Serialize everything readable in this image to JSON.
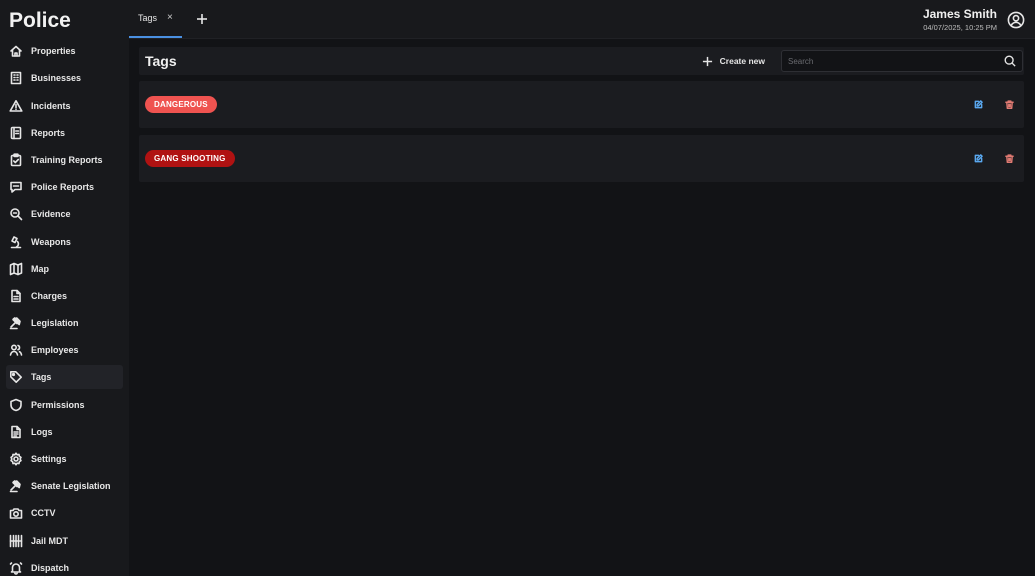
{
  "app": {
    "title": "Police"
  },
  "sidebar": {
    "items": [
      {
        "label": "Properties",
        "icon": "home-icon"
      },
      {
        "label": "Businesses",
        "icon": "building-icon"
      },
      {
        "label": "Incidents",
        "icon": "warning-icon"
      },
      {
        "label": "Reports",
        "icon": "report-icon"
      },
      {
        "label": "Training Reports",
        "icon": "clipboard-icon"
      },
      {
        "label": "Police Reports",
        "icon": "message-icon"
      },
      {
        "label": "Evidence",
        "icon": "magnify-icon"
      },
      {
        "label": "Weapons",
        "icon": "microscope-icon"
      },
      {
        "label": "Map",
        "icon": "map-icon"
      },
      {
        "label": "Charges",
        "icon": "document-icon"
      },
      {
        "label": "Legislation",
        "icon": "gavel-icon"
      },
      {
        "label": "Employees",
        "icon": "users-icon"
      },
      {
        "label": "Tags",
        "icon": "tag-icon"
      },
      {
        "label": "Permissions",
        "icon": "shield-icon"
      },
      {
        "label": "Logs",
        "icon": "file-text-icon"
      },
      {
        "label": "Settings",
        "icon": "gear-icon"
      },
      {
        "label": "Senate Legislation",
        "icon": "gavel-icon"
      },
      {
        "label": "CCTV",
        "icon": "camera-icon"
      },
      {
        "label": "Jail MDT",
        "icon": "jail-icon"
      },
      {
        "label": "Dispatch",
        "icon": "bell-icon"
      }
    ],
    "active": "Tags"
  },
  "tabs": [
    {
      "label": "Tags",
      "close": "×"
    }
  ],
  "user": {
    "name": "James Smith",
    "datetime": "04/07/2025, 10:25 PM"
  },
  "page": {
    "title": "Tags",
    "create_label": "Create new",
    "search_placeholder": "Search"
  },
  "tags": [
    {
      "label": "DANGEROUS",
      "color": "#ef5350"
    },
    {
      "label": "GANG SHOOTING",
      "color": "#b01212"
    }
  ]
}
